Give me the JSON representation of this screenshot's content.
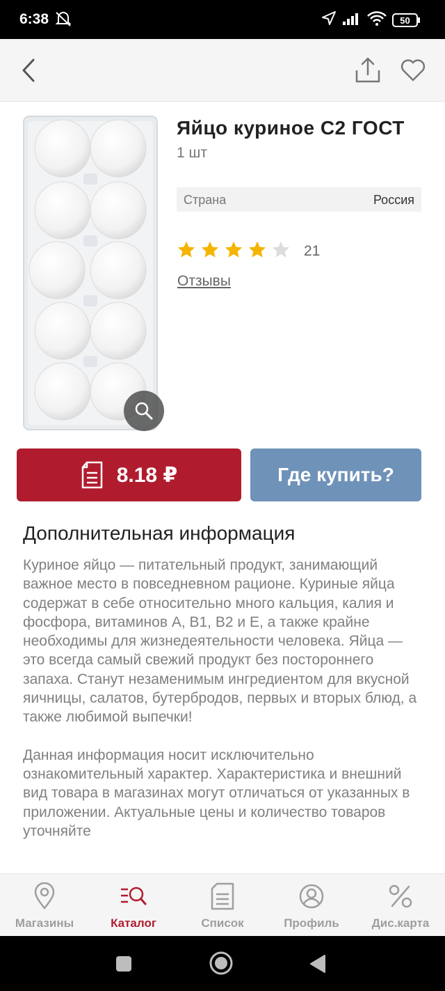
{
  "status_bar": {
    "time": "6:38",
    "battery": "50"
  },
  "app_bar": {
    "back_icon": "chevron-left-icon",
    "share_icon": "share-icon",
    "favorite_icon": "heart-icon"
  },
  "product": {
    "title": "Яйцо куриное С2 ГОСТ",
    "quantity": "1 шт",
    "attributes": [
      {
        "key": "Страна",
        "value": "Россия"
      }
    ],
    "rating": {
      "value": 4,
      "max": 5,
      "count": "21"
    },
    "reviews_label": "Отзывы"
  },
  "actions": {
    "price": "8.18 ₽",
    "where_to_buy": "Где купить?"
  },
  "info": {
    "heading": "Дополнительная информация",
    "paragraph1": "Куриное яйцо — питательный продукт, занимающий важное место в повседневном рационе. Куриные яйца содержат в себе относительно много кальция, калия и фосфора, витаминов А, В1, В2 и Е, а также крайне необходимы для жизнедеятельности человека. Яйца — это всегда самый свежий продукт без постороннего запаха. Станут незаменимым ингредиентом для вкусной яичницы, салатов, бутербродов, первых и вторых блюд, а также любимой выпечки!",
    "paragraph2": "Данная информация носит исключительно ознакомительный характер. Характеристика и внешний вид товара в магазинах могут отличаться от указанных в приложении. Актуальные цены и количество товаров уточняйте"
  },
  "bottom_nav": [
    {
      "label": "Магазины",
      "icon": "map-pin-icon",
      "active": false
    },
    {
      "label": "Каталог",
      "icon": "catalog-search-icon",
      "active": true
    },
    {
      "label": "Список",
      "icon": "list-icon",
      "active": false
    },
    {
      "label": "Профиль",
      "icon": "profile-icon",
      "active": false
    },
    {
      "label": "Дис.карта",
      "icon": "percent-icon",
      "active": false
    }
  ],
  "colors": {
    "brand_red": "#b01c2e",
    "button_blue": "#6f92b8",
    "star_gold": "#f5b400",
    "star_empty": "#dddddd"
  }
}
